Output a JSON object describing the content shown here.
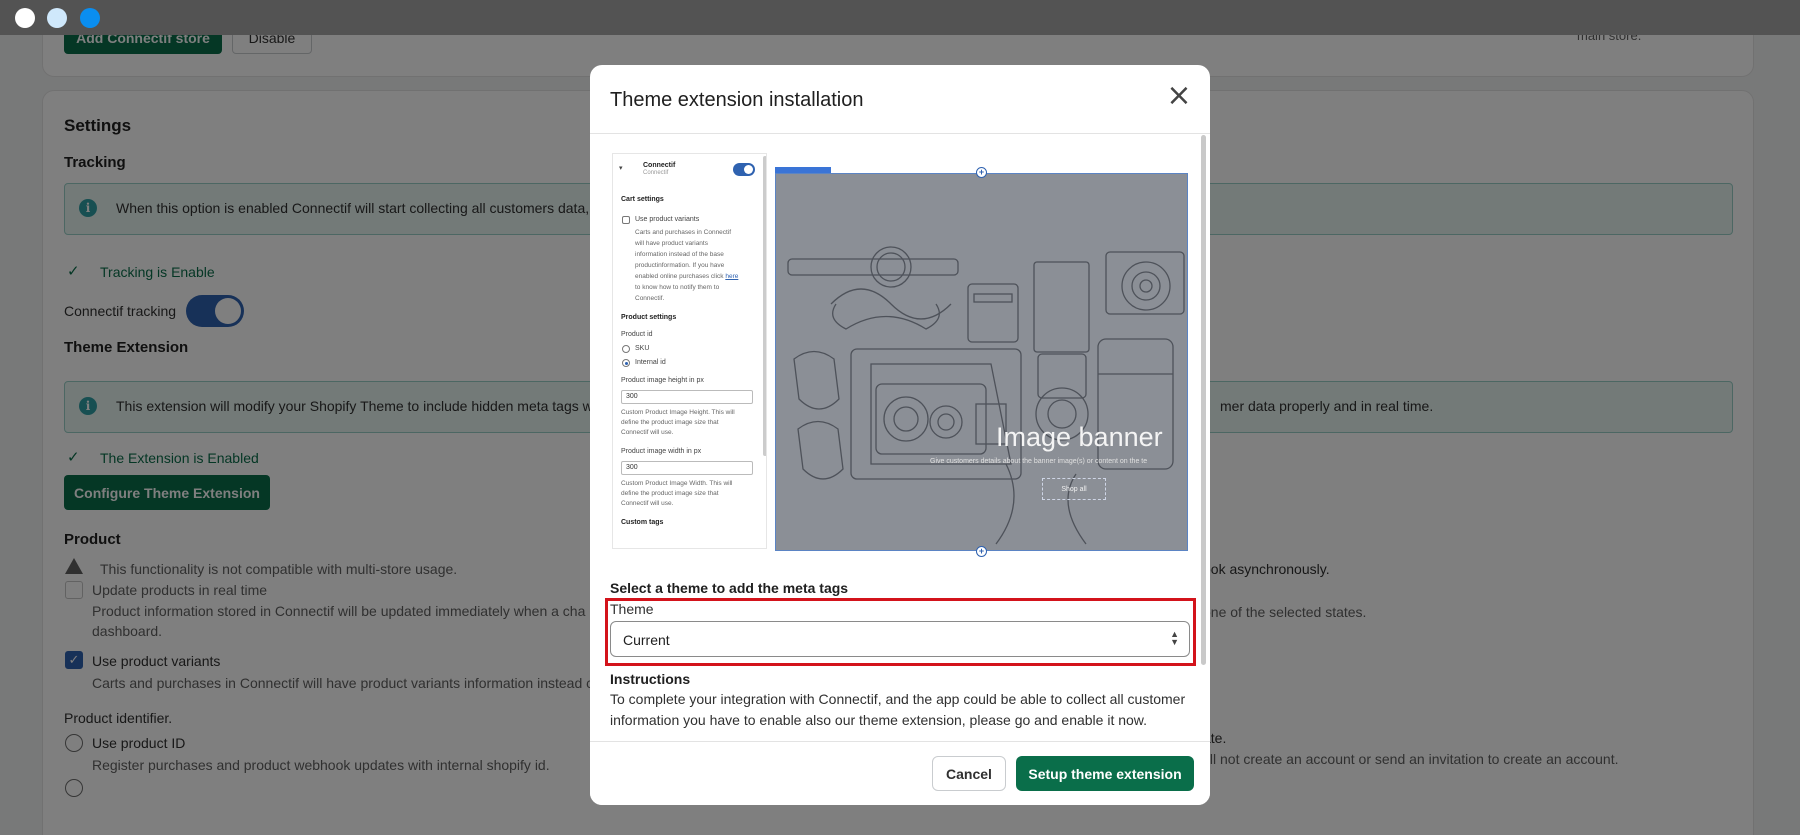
{
  "window": {
    "controls": [
      "close",
      "minimize",
      "maximize"
    ]
  },
  "background": {
    "top_buttons": {
      "add_store": "Add Connectif store",
      "disable": "Disable"
    },
    "right_snippet": "main store.",
    "settings": {
      "title": "Settings",
      "tracking_title": "Tracking",
      "tracking_banner": "When this option is enabled Connectif will start collecting all customers data,",
      "tracking_status_prefix": "Tracking is ",
      "tracking_status_value": "Enable",
      "tracking_toggle_label": "Connectif tracking",
      "theme_ext_title": "Theme Extension",
      "theme_ext_banner": "This extension will modify your Shopify Theme to include hidden meta tags w",
      "theme_ext_banner_tail": "mer data properly and in real time.",
      "ext_status_prefix": "The Extension is ",
      "ext_status_value": "Enabled",
      "configure_button": "Configure Theme Extension",
      "product_title": "Product",
      "warning_text": "This functionality is not compatible with multi-store usage.",
      "update_realtime_label": "Update products in real time",
      "update_realtime_desc1": "Product information stored in Connectif will be updated immediately when a cha",
      "update_realtime_desc2": "dashboard.",
      "use_variants_label": "Use product variants",
      "use_variants_desc": "Carts and purchases in Connectif will have product variants information instead c",
      "identifier_label": "Product identifier.",
      "use_id_label": "Use product ID",
      "use_id_desc": "Register purchases and product webhook updates with internal shopify id.",
      "right_text1": "ook asynchronously.",
      "right_text2": "one of the selected states.",
      "right_text3": "ate.",
      "right_text4": "This will create a contact in your shop but will not create an account or send an invitation to create an account."
    }
  },
  "modal": {
    "title": "Theme extension installation",
    "preview": {
      "app_name": "Connectif",
      "app_sub": "Connectif",
      "cart_settings": "Cart settings",
      "use_variants": "Use product variants",
      "variants_desc": [
        "Carts and purchases in Connectif",
        "will have product variants",
        "information instead of the base",
        "productinformation. If you have",
        "enabled online purchases click ",
        "to know how to notify them to",
        "Connectif."
      ],
      "here_link": "here",
      "product_settings": "Product settings",
      "product_id": "Product id",
      "sku": "SKU",
      "internal_id": "Internal id",
      "height_label": "Product image height in px",
      "height_value": "300",
      "height_desc": [
        "Custom Product Image Height. This will",
        "define the product image size that",
        "Connectif will use."
      ],
      "width_label": "Product image width in px",
      "width_value": "300",
      "width_desc": [
        "Custom Product Image Width. This will",
        "define the product image size that",
        "Connectif will use."
      ],
      "custom_tags": "Custom tags",
      "banner_title": "Image banner",
      "banner_subtitle": "Give customers details about the banner image(s) or content on the te",
      "banner_button": "Shop all"
    },
    "select_heading": "Select a theme to add the meta tags",
    "theme_label": "Theme",
    "theme_value": "Current",
    "instructions_title": "Instructions",
    "instructions_text": "To complete your integration with Connectif, and the app could be able to collect all customer information you have to enable also our theme extension, please go and enable it now.",
    "cancel": "Cancel",
    "setup": "Setup theme extension"
  }
}
